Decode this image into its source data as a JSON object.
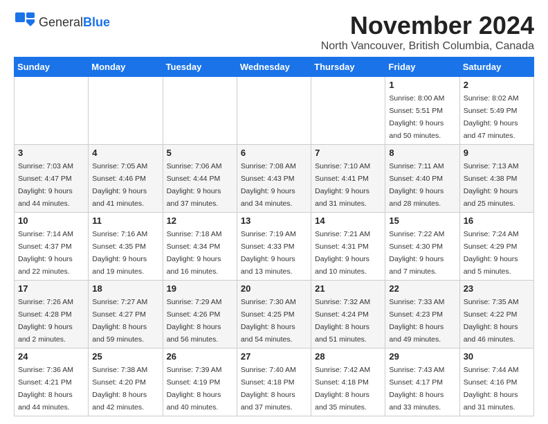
{
  "header": {
    "logo_general": "General",
    "logo_blue": "Blue",
    "month_title": "November 2024",
    "location": "North Vancouver, British Columbia, Canada"
  },
  "weekdays": [
    "Sunday",
    "Monday",
    "Tuesday",
    "Wednesday",
    "Thursday",
    "Friday",
    "Saturday"
  ],
  "weeks": [
    [
      {
        "day": "",
        "info": ""
      },
      {
        "day": "",
        "info": ""
      },
      {
        "day": "",
        "info": ""
      },
      {
        "day": "",
        "info": ""
      },
      {
        "day": "",
        "info": ""
      },
      {
        "day": "1",
        "info": "Sunrise: 8:00 AM\nSunset: 5:51 PM\nDaylight: 9 hours and 50 minutes."
      },
      {
        "day": "2",
        "info": "Sunrise: 8:02 AM\nSunset: 5:49 PM\nDaylight: 9 hours and 47 minutes."
      }
    ],
    [
      {
        "day": "3",
        "info": "Sunrise: 7:03 AM\nSunset: 4:47 PM\nDaylight: 9 hours and 44 minutes."
      },
      {
        "day": "4",
        "info": "Sunrise: 7:05 AM\nSunset: 4:46 PM\nDaylight: 9 hours and 41 minutes."
      },
      {
        "day": "5",
        "info": "Sunrise: 7:06 AM\nSunset: 4:44 PM\nDaylight: 9 hours and 37 minutes."
      },
      {
        "day": "6",
        "info": "Sunrise: 7:08 AM\nSunset: 4:43 PM\nDaylight: 9 hours and 34 minutes."
      },
      {
        "day": "7",
        "info": "Sunrise: 7:10 AM\nSunset: 4:41 PM\nDaylight: 9 hours and 31 minutes."
      },
      {
        "day": "8",
        "info": "Sunrise: 7:11 AM\nSunset: 4:40 PM\nDaylight: 9 hours and 28 minutes."
      },
      {
        "day": "9",
        "info": "Sunrise: 7:13 AM\nSunset: 4:38 PM\nDaylight: 9 hours and 25 minutes."
      }
    ],
    [
      {
        "day": "10",
        "info": "Sunrise: 7:14 AM\nSunset: 4:37 PM\nDaylight: 9 hours and 22 minutes."
      },
      {
        "day": "11",
        "info": "Sunrise: 7:16 AM\nSunset: 4:35 PM\nDaylight: 9 hours and 19 minutes."
      },
      {
        "day": "12",
        "info": "Sunrise: 7:18 AM\nSunset: 4:34 PM\nDaylight: 9 hours and 16 minutes."
      },
      {
        "day": "13",
        "info": "Sunrise: 7:19 AM\nSunset: 4:33 PM\nDaylight: 9 hours and 13 minutes."
      },
      {
        "day": "14",
        "info": "Sunrise: 7:21 AM\nSunset: 4:31 PM\nDaylight: 9 hours and 10 minutes."
      },
      {
        "day": "15",
        "info": "Sunrise: 7:22 AM\nSunset: 4:30 PM\nDaylight: 9 hours and 7 minutes."
      },
      {
        "day": "16",
        "info": "Sunrise: 7:24 AM\nSunset: 4:29 PM\nDaylight: 9 hours and 5 minutes."
      }
    ],
    [
      {
        "day": "17",
        "info": "Sunrise: 7:26 AM\nSunset: 4:28 PM\nDaylight: 9 hours and 2 minutes."
      },
      {
        "day": "18",
        "info": "Sunrise: 7:27 AM\nSunset: 4:27 PM\nDaylight: 8 hours and 59 minutes."
      },
      {
        "day": "19",
        "info": "Sunrise: 7:29 AM\nSunset: 4:26 PM\nDaylight: 8 hours and 56 minutes."
      },
      {
        "day": "20",
        "info": "Sunrise: 7:30 AM\nSunset: 4:25 PM\nDaylight: 8 hours and 54 minutes."
      },
      {
        "day": "21",
        "info": "Sunrise: 7:32 AM\nSunset: 4:24 PM\nDaylight: 8 hours and 51 minutes."
      },
      {
        "day": "22",
        "info": "Sunrise: 7:33 AM\nSunset: 4:23 PM\nDaylight: 8 hours and 49 minutes."
      },
      {
        "day": "23",
        "info": "Sunrise: 7:35 AM\nSunset: 4:22 PM\nDaylight: 8 hours and 46 minutes."
      }
    ],
    [
      {
        "day": "24",
        "info": "Sunrise: 7:36 AM\nSunset: 4:21 PM\nDaylight: 8 hours and 44 minutes."
      },
      {
        "day": "25",
        "info": "Sunrise: 7:38 AM\nSunset: 4:20 PM\nDaylight: 8 hours and 42 minutes."
      },
      {
        "day": "26",
        "info": "Sunrise: 7:39 AM\nSunset: 4:19 PM\nDaylight: 8 hours and 40 minutes."
      },
      {
        "day": "27",
        "info": "Sunrise: 7:40 AM\nSunset: 4:18 PM\nDaylight: 8 hours and 37 minutes."
      },
      {
        "day": "28",
        "info": "Sunrise: 7:42 AM\nSunset: 4:18 PM\nDaylight: 8 hours and 35 minutes."
      },
      {
        "day": "29",
        "info": "Sunrise: 7:43 AM\nSunset: 4:17 PM\nDaylight: 8 hours and 33 minutes."
      },
      {
        "day": "30",
        "info": "Sunrise: 7:44 AM\nSunset: 4:16 PM\nDaylight: 8 hours and 31 minutes."
      }
    ]
  ]
}
